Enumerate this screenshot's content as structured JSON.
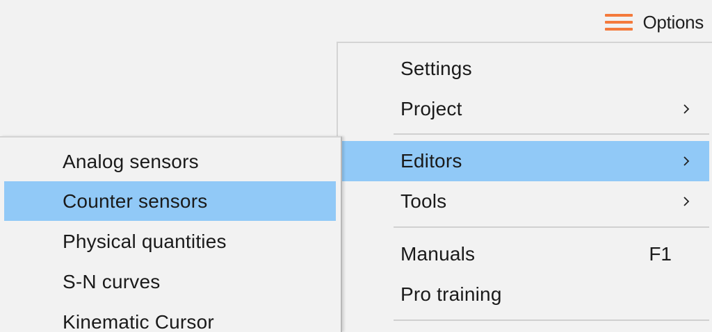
{
  "toolbar": {
    "options_icon": "hamburger-icon",
    "options_label": "Options",
    "accent_color": "#f47a3c"
  },
  "main_menu": {
    "highlight_color": "#91c9f7",
    "items": [
      {
        "label": "Settings"
      },
      {
        "label": "Project",
        "submenu_icon": "chevron-right-icon"
      },
      {
        "label": "Editors",
        "submenu_icon": "chevron-right-icon",
        "highlighted": true
      },
      {
        "label": "Tools",
        "submenu_icon": "chevron-right-icon"
      },
      {
        "label": "Manuals",
        "shortcut": "F1"
      },
      {
        "label": "Pro training"
      }
    ]
  },
  "editors_submenu": {
    "items": [
      {
        "label": "Analog sensors"
      },
      {
        "label": "Counter sensors",
        "highlighted": true
      },
      {
        "label": "Physical quantities"
      },
      {
        "label": "S-N curves"
      },
      {
        "label": "Kinematic Cursor"
      }
    ]
  }
}
